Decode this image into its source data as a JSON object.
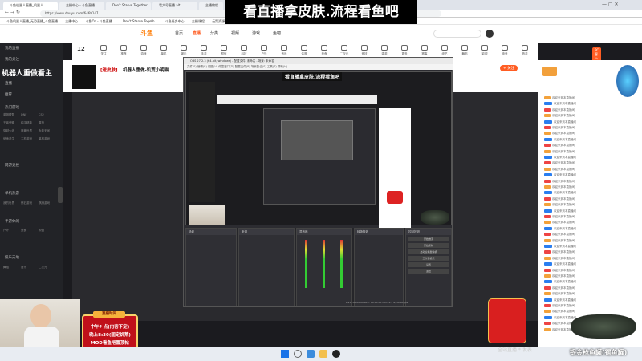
{
  "banner": {
    "text": "看直播拿皮肤.流程看鱼吧"
  },
  "browser": {
    "tabs": [
      "斗鱼机器人直播_机器人...",
      "主播中心 - 斗鱼直播",
      "Don't Starve Together...",
      "看大号直播 alt...",
      "主播教程 ..."
    ],
    "url": "https://www.douyu.com/6469147"
  },
  "bookmarks": [
    "斗鱼机器人直播_无恐直播_斗鱼直播",
    "主播中心",
    "斗鱼Oz - 斗鱼直播...",
    "Don't Starve Togeth...",
    "斗鱼任务中心",
    "主播课程",
    "云策资源 OW装"
  ],
  "site": {
    "logo": "斗鱼",
    "nav": [
      "首页",
      "直播",
      "分类",
      "视频",
      "游戏",
      "鱼吧"
    ],
    "active": "直播"
  },
  "categories": {
    "level": "12",
    "items": [
      "关注",
      "推荐",
      "游戏",
      "单机",
      "娱乐",
      "手游",
      "颜值",
      "科技",
      "户外",
      "音乐",
      "体育",
      "美食",
      "二次元",
      "竞技",
      "端游",
      "更多",
      "赛事",
      "综艺",
      "舞蹈",
      "影视",
      "电竞",
      "旅游"
    ]
  },
  "sidebar": {
    "sidebar_title": "机器人重做看主",
    "items": [
      "我的直播",
      "我的关注",
      "直播",
      "推荐",
      "热门游戏",
      "网游竞技",
      "单机热游",
      "手游休闲",
      "娱乐天地",
      "科技文化",
      "语音直播",
      "正能量"
    ],
    "grid": [
      "英雄联盟",
      "DNF",
      "CS2",
      "王者荣耀",
      "和平精英",
      "原神",
      "穿越火线",
      "魔兽世界",
      "永劫无间",
      "绝地求生",
      "主机游戏",
      "单机游戏",
      "我的世界",
      "怀旧游戏",
      "棋牌游戏",
      "户外",
      "美食",
      "颜值",
      "舞蹈",
      "音乐",
      "二次元"
    ]
  },
  "room": {
    "tag": "[送皮肤]",
    "title": "机器人重做-饥荒小明猫",
    "follow_btn": "+ 关注",
    "pc_btn": "PC客户端"
  },
  "obs": {
    "title": "OBS 27.2.3 (64-bit, windows) - 配置文件: 未命名 - 场景: 未命名",
    "menu": [
      "文件(F)",
      "编辑(E)",
      "视图(V)",
      "停靠窗口(D)",
      "配置文件(P)",
      "场景集合(S)",
      "工具(T)",
      "帮助(H)"
    ],
    "preview_text": "看直播拿皮肤.流程看鱼吧",
    "docks": [
      {
        "title": "场景"
      },
      {
        "title": "来源"
      },
      {
        "title": "混音器"
      },
      {
        "title": "转场特效"
      },
      {
        "title": "控制按钮"
      }
    ],
    "controls": [
      "开始推流",
      "开始录制",
      "启动虚拟摄像机",
      "工作室模式",
      "设置",
      "退出"
    ],
    "status": "LIVE: 00:00:00  REC: 00:00:00  CPU: 4.3%, 30.00 fps"
  },
  "chat": {
    "messages": [
      "欢迎来到本直播间",
      "欢迎来到本直播间",
      "欢迎来到本直播间",
      "欢迎来到本直播间",
      "欢迎来到本直播间",
      "欢迎来到本直播间",
      "欢迎来到本直播间",
      "欢迎来到本直播间",
      "欢迎来到本直播间",
      "欢迎来到本直播间",
      "欢迎来到本直播间",
      "欢迎来到本直播间",
      "欢迎来到本直播间",
      "欢迎来到本直播间",
      "欢迎来到本直播间",
      "欢迎来到本直播间",
      "欢迎来到本直播间",
      "欢迎来到本直播间",
      "欢迎来到本直播间",
      "欢迎来到本直播间",
      "欢迎来到本直播间",
      "欢迎来到本直播间",
      "欢迎来到本直播间",
      "欢迎来到本直播间",
      "欢迎来到本直播间",
      "欢迎来到本直播间",
      "欢迎来到本直播间",
      "欢迎来到本直播间",
      "欢迎来到本直播间",
      "欢迎来到本直播间",
      "欢迎来到本直播间",
      "欢迎来到本直播间",
      "欢迎来到本直播间",
      "欢迎来到本直播间",
      "欢迎来到本直播间",
      "欢迎来到本直播间",
      "欢迎来到本直播间",
      "欢迎来到本直播间",
      "欢迎来到本直播间",
      "欢迎来到本直播间"
    ]
  },
  "schedule": {
    "head": "直播时间",
    "line1": "中午? 点(内容不定)",
    "line2": "晚上8:30(固定饥荒)",
    "line3": "MOD看鱼吧置顶帖"
  },
  "footer": {
    "nickname": "银金枪鱼罐(锡鱼罐)",
    "caption": "全站直播 * 发表..."
  },
  "colors": {
    "accent": "#ff5d23",
    "chat_badge": "#f3a23b",
    "schedule_bg": "#c0101a"
  }
}
